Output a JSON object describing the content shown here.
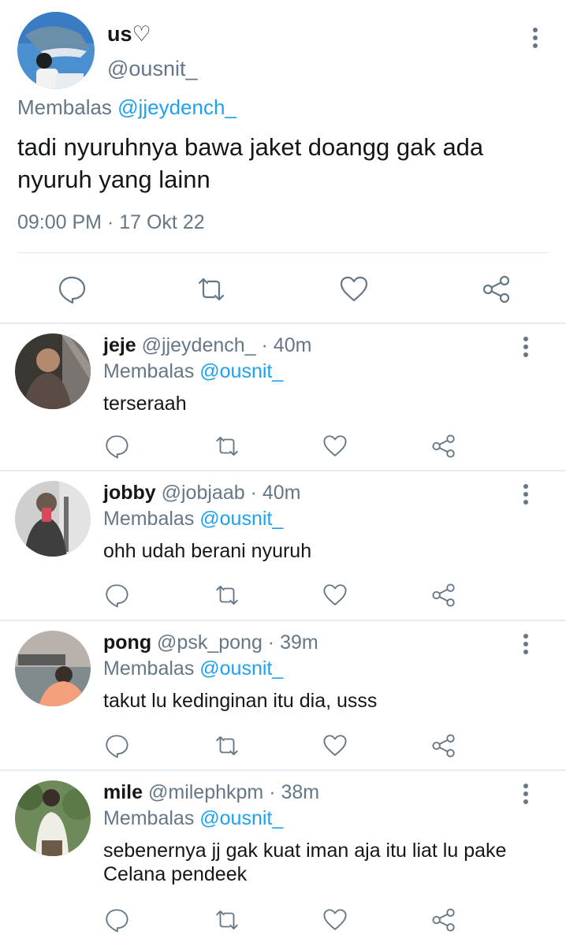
{
  "main_tweet": {
    "display_name": "us♡",
    "handle": "@ousnit_",
    "replying_prefix": "Membalas ",
    "replying_to": "@jjeydench_",
    "text": "tadi nyuruhnya bawa jaket doangg gak ada nyuruh yang lainn",
    "timestamp": "09:00 PM · 17 Okt 22",
    "actions": [
      "reply-icon",
      "retweet-icon",
      "like-icon",
      "share-icon"
    ]
  },
  "replies": [
    {
      "display_name": "jeje",
      "handle": "@jjeydench_",
      "time": " · 40m",
      "replying_prefix": "Membalas ",
      "replying_to": "@ousnit_",
      "text": "terseraah"
    },
    {
      "display_name": "jobby",
      "handle": "@jobjaab",
      "time": " · 40m",
      "replying_prefix": "Membalas ",
      "replying_to": "@ousnit_",
      "text": "ohh udah berani nyuruh"
    },
    {
      "display_name": "pong",
      "handle": "@psk_pong",
      "time": " · 39m",
      "replying_prefix": "Membalas ",
      "replying_to": "@ousnit_",
      "text": "takut lu kedinginan itu dia, usss"
    },
    {
      "display_name": "mile",
      "handle": "@milephkpm",
      "time": " · 38m",
      "replying_prefix": "Membalas ",
      "replying_to": "@ousnit_",
      "text": "sebenernya jj gak kuat iman aja itu liat lu pake Celana pendeek"
    }
  ],
  "colors": {
    "accent": "#1da1f2",
    "secondary_text": "#657786",
    "divider": "#e6ecf0"
  }
}
